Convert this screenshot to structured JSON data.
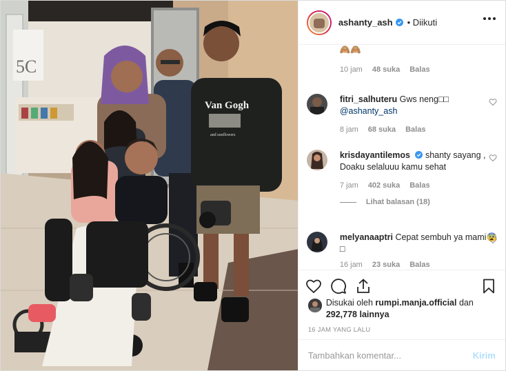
{
  "header": {
    "username": "ashanty_ash",
    "follow_state": "• Diikuti"
  },
  "comments": [
    {
      "id": "partial",
      "text": "🙈🙈",
      "time": "10 jam",
      "likes": "48 suka",
      "reply": "Balas"
    },
    {
      "id": "fitri",
      "username": "fitri_salhuteru",
      "text": "Gws neng□□",
      "mention": "@ashanty_ash",
      "time": "8 jam",
      "likes": "68 suka",
      "reply": "Balas"
    },
    {
      "id": "krisdayanti",
      "username": "krisdayantilemos",
      "text": "shanty sayang , Doaku selaluuu kamu sehat",
      "time": "7 jam",
      "likes": "402 suka",
      "reply": "Balas",
      "view_replies": "Lihat balasan (18)"
    },
    {
      "id": "melyana",
      "username": "melyanaaptri",
      "text": "Cepat sembuh ya mami😨□",
      "time": "16 jam",
      "likes": "23 suka",
      "reply": "Balas"
    }
  ],
  "likes": {
    "prefix": "Disukai oleh",
    "by": "rumpi.manja.official",
    "and": "dan",
    "others": "292,778 lainnya"
  },
  "timestamp": "16 JAM YANG LALU",
  "add_comment": {
    "placeholder": "Tambahkan komentar...",
    "post_label": "Kirim"
  },
  "photo": {
    "shirt_text": "Van Gogh",
    "shirt_subtext": "and sunflowers",
    "wall_sign": "5C"
  }
}
